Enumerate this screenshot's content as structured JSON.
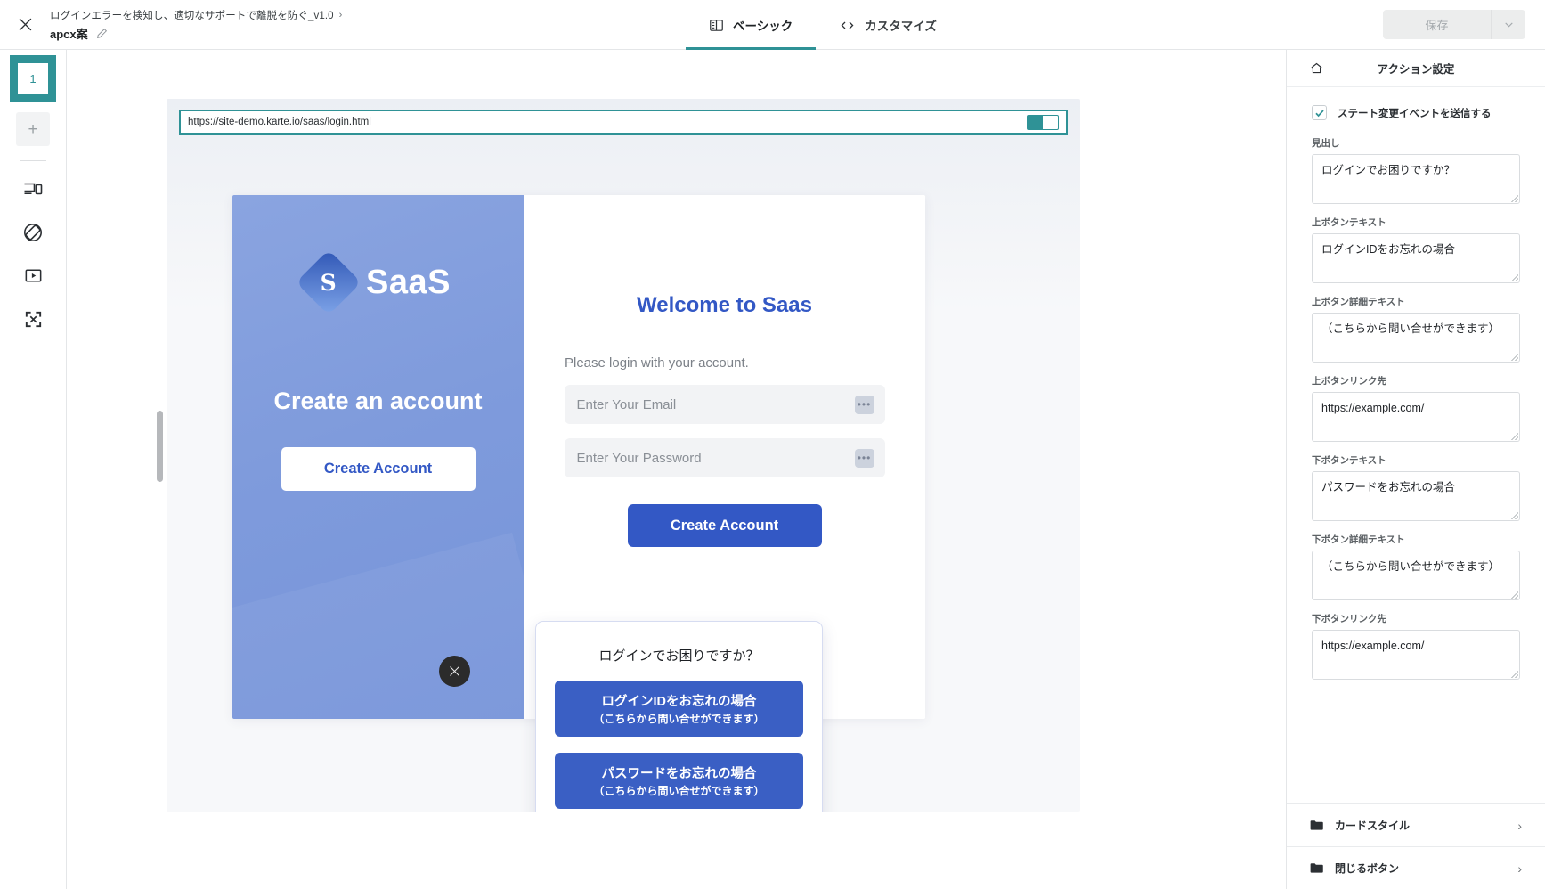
{
  "topbar": {
    "close_icon": "close-icon",
    "breadcrumb": "ログインエラーを検知し、適切なサポートで離脱を防ぐ_v1.0",
    "breadcrumb_chevron": "›",
    "doc_title": "apcx案",
    "edit_icon": "pencil-icon",
    "tabs": [
      {
        "label": "ベーシック",
        "icon": "layout-panel-icon",
        "active": true
      },
      {
        "label": "カスタマイズ",
        "icon": "code-icon",
        "active": false
      }
    ],
    "save_label": "保存",
    "save_caret_icon": "chevron-down-icon"
  },
  "rail": {
    "active_slot_number": "1",
    "add_label": "+",
    "icons": [
      "responsive-device-icon",
      "rotate-device-icon",
      "play-frame-icon",
      "fullscreen-icon"
    ]
  },
  "preview": {
    "url": "https://site-demo.karte.io/saas/login.html",
    "url_toggle_state": "on",
    "drag_handle_left": "resize-handle-left",
    "drag_handle_right": "resize-handle-right",
    "hscrollbar": "horizontal-scrollbar",
    "page": {
      "brand_letter": "S",
      "brand_name": "SaaS",
      "left_heading": "Create an account",
      "left_button": "Create Account",
      "welcome_title": "Welcome to Saas",
      "subtitle": "Please login with your account.",
      "email_placeholder": "Enter Your Email",
      "password_placeholder": "Enter Your Password",
      "field_dots": "•••",
      "submit_label": "Create Account"
    },
    "modal": {
      "title": "ログインでお困りですか？",
      "close_icon": "close-icon",
      "buttons": [
        {
          "main": "ログインIDをお忘れの場合",
          "sub": "（こちらから問い合せができます）"
        },
        {
          "main": "パスワードをお忘れの場合",
          "sub": "（こちらから問い合せができます）"
        }
      ]
    }
  },
  "panel": {
    "home_icon": "home-icon",
    "title": "アクション設定",
    "checkbox": {
      "label": "ステート変更イベントを送信する",
      "checked": true,
      "icon": "check-icon"
    },
    "fields": [
      {
        "label": "見出し",
        "value": "ログインでお困りですか？"
      },
      {
        "label": "上ボタンテキスト",
        "value": "ログインIDをお忘れの場合"
      },
      {
        "label": "上ボタン詳細テキスト",
        "value": "（こちらから問い合せができます）"
      },
      {
        "label": "上ボタンリンク先",
        "value": "https://example.com/"
      },
      {
        "label": "下ボタンテキスト",
        "value": "パスワードをお忘れの場合"
      },
      {
        "label": "下ボタン詳細テキスト",
        "value": "（こちらから問い合せができます）"
      },
      {
        "label": "下ボタンリンク先",
        "value": "https://example.com/"
      }
    ],
    "accordions": [
      {
        "label": "カードスタイル",
        "icon": "folder-icon",
        "chevron": "›"
      },
      {
        "label": "閉じるボタン",
        "icon": "folder-icon",
        "chevron": "›"
      }
    ]
  },
  "colors": {
    "accent": "#2f9296",
    "brand_blue": "#3358c5",
    "modal_button": "#3a5fc4",
    "panel_border": "#e4e6e8"
  }
}
